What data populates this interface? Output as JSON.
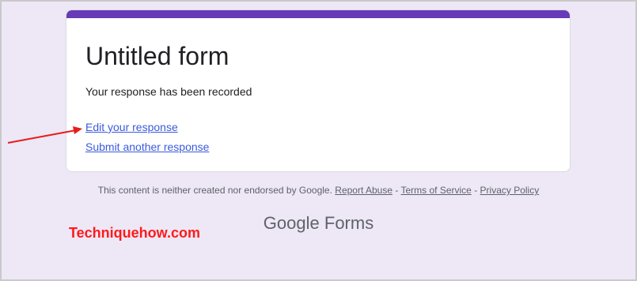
{
  "form": {
    "title": "Untitled form",
    "message": "Your response has been recorded",
    "edit_link": "Edit your response",
    "submit_another_link": "Submit another response",
    "accent_color": "#673ab7"
  },
  "footer": {
    "disclaimer": "This content is neither created nor endorsed by Google.",
    "report_abuse": "Report Abuse",
    "separator": "-",
    "terms": "Terms of Service",
    "privacy": "Privacy Policy"
  },
  "logo": {
    "google": "Google",
    "forms": "Forms"
  },
  "watermark": "Techniquehow.com",
  "annotation": {
    "icon": "red-arrow-icon",
    "color": "#e81c1c"
  }
}
